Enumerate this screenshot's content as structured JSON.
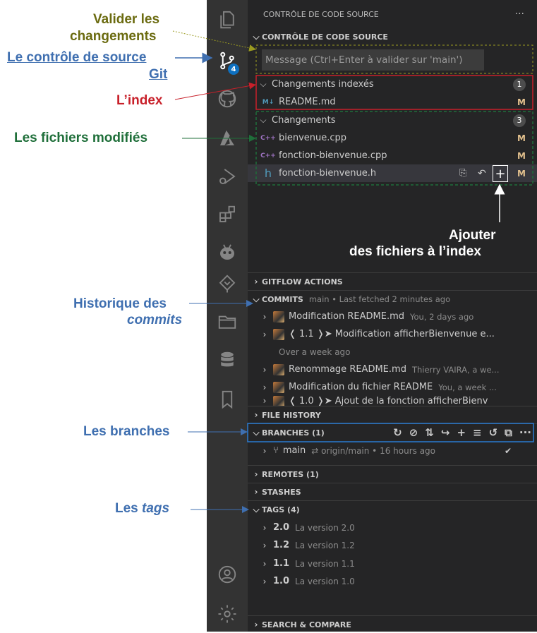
{
  "annotations": {
    "valider_line1": "Valider les",
    "valider_line2": "changements",
    "git_line1": "Le contrôle de source",
    "git_line2": "Git",
    "index": "L’index",
    "modified": "Les fichiers modifiés",
    "add_line1": "Ajouter",
    "add_line2": "des fichiers à l’index",
    "history_line1": "Historique des",
    "history_line2": "commits",
    "branches": "Les branches",
    "tags_prefix": "Les",
    "tags_word": "tags"
  },
  "activity_bar": {
    "scm_badge": "4",
    "icons": [
      "explorer-icon",
      "source-control-icon",
      "github-icon",
      "azure-icon",
      "run-debug-icon",
      "extensions-icon",
      "platformio-icon",
      "gitflow-tree-icon",
      "folder-icon",
      "database-icon",
      "bookmark-icon",
      "account-icon",
      "settings-gear-icon"
    ]
  },
  "panel": {
    "title": "CONTRÔLE DE CODE SOURCE",
    "more": "···",
    "section_scm": "CONTRÔLE DE CODE SOURCE",
    "commit_placeholder": "Message (Ctrl+Enter à valider sur 'main')",
    "staged": {
      "label": "Changements indexés",
      "count": "1",
      "files": [
        {
          "icon": "M↓",
          "name": "README.md",
          "status": "M"
        }
      ]
    },
    "changes": {
      "label": "Changements",
      "count": "3",
      "files": [
        {
          "icon": "C++",
          "name": "bienvenue.cpp",
          "status": "M"
        },
        {
          "icon": "C++",
          "name": "fonction-bienvenue.cpp",
          "status": "M"
        },
        {
          "icon": "h",
          "name": "fonction-bienvenue.h",
          "status": "M"
        }
      ]
    },
    "gitflow": "GITFLOW ACTIONS",
    "commits": {
      "label": "COMMITS",
      "meta": "main • Last fetched 2 minutes ago",
      "items": [
        {
          "text": "Modification README.md",
          "meta": "You, 2 days ago"
        },
        {
          "text": "❬ 1.1 ❭➤ Modification afficherBienvenue e...",
          "meta": ""
        },
        {
          "text": "Renommage README.md",
          "meta": "Thierry VAIRA, a we..."
        },
        {
          "text": "Modification du fichier README",
          "meta": "You, a week ..."
        },
        {
          "text": "❬ 1.0 ❭➤ Ajout de la fonction afficherBienv",
          "meta": ""
        }
      ],
      "group": "Over a week ago"
    },
    "file_history": "FILE HISTORY",
    "branches": {
      "label": "BRANCHES (1)",
      "item": "main",
      "item_meta": "⇄ origin/main • 16 hours ago",
      "check": "✔"
    },
    "remotes": "REMOTES (1)",
    "stashes": "STASHES",
    "tags": {
      "label": "TAGS (4)",
      "items": [
        {
          "name": "2.0",
          "desc": "La version 2.0"
        },
        {
          "name": "1.2",
          "desc": "La version 1.2"
        },
        {
          "name": "1.1",
          "desc": "La version 1.1"
        },
        {
          "name": "1.0",
          "desc": "La version 1.0"
        }
      ]
    },
    "search": "SEARCH & COMPARE"
  },
  "colors": {
    "activity_bg": "#333333",
    "panel_bg": "#252526",
    "badge": "#0e70c0",
    "modified": "#e2c08d",
    "cpp_icon": "#a074c4",
    "h_icon": "#519aba"
  }
}
